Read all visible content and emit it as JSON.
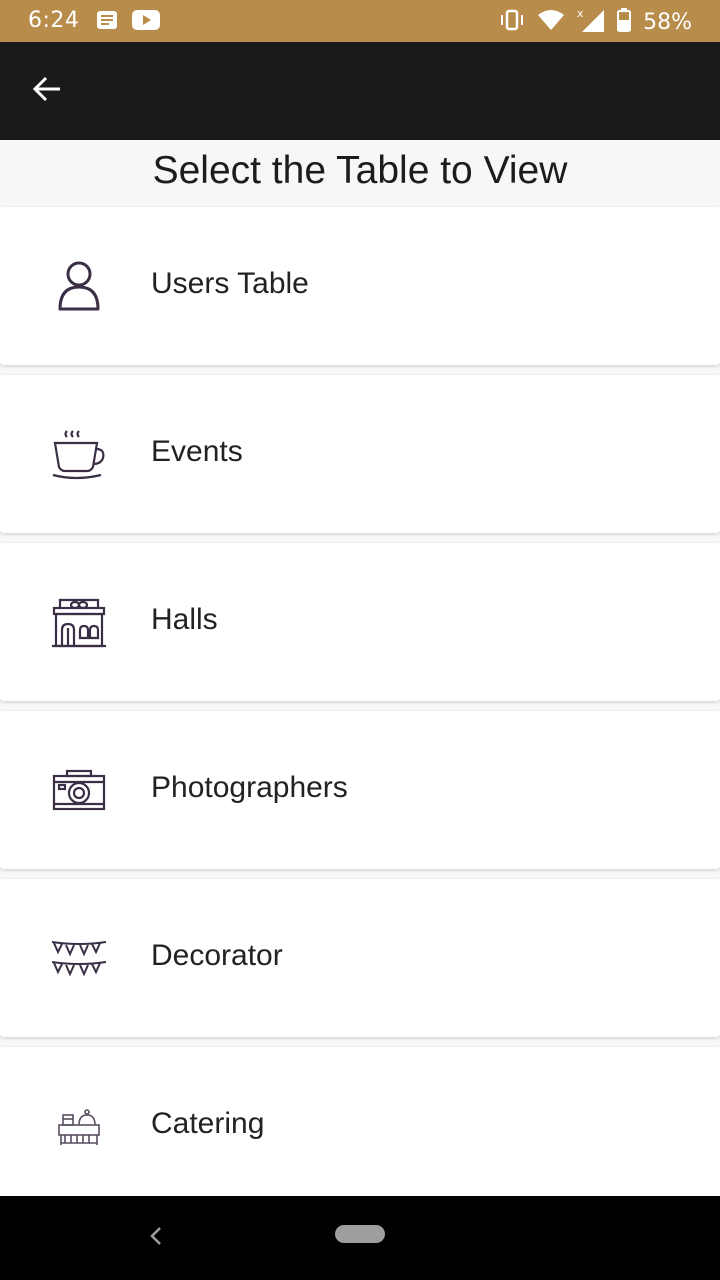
{
  "status_bar": {
    "time": "6:24",
    "battery": "58%",
    "icons": [
      "notes-icon",
      "youtube-icon",
      "vibrate-icon",
      "wifi-icon",
      "signal-icon",
      "battery-icon"
    ]
  },
  "app_bar": {
    "back_icon": "arrow-left-icon"
  },
  "page": {
    "title": "Select the Table to View"
  },
  "tables": [
    {
      "label": "Users Table",
      "icon": "user-icon"
    },
    {
      "label": "Events",
      "icon": "coffee-cup-icon"
    },
    {
      "label": "Halls",
      "icon": "hall-building-icon"
    },
    {
      "label": "Photographers",
      "icon": "camera-icon"
    },
    {
      "label": "Decorator",
      "icon": "bunting-icon"
    },
    {
      "label": "Catering",
      "icon": "catering-icon"
    }
  ],
  "nav_bar": {
    "back_icon": "nav-back-icon",
    "home_icon": "home-pill-icon"
  },
  "colors": {
    "status_bar": "#b88c4a",
    "app_bar": "#1a1a1a",
    "icon_stroke": "#3a2f45"
  }
}
